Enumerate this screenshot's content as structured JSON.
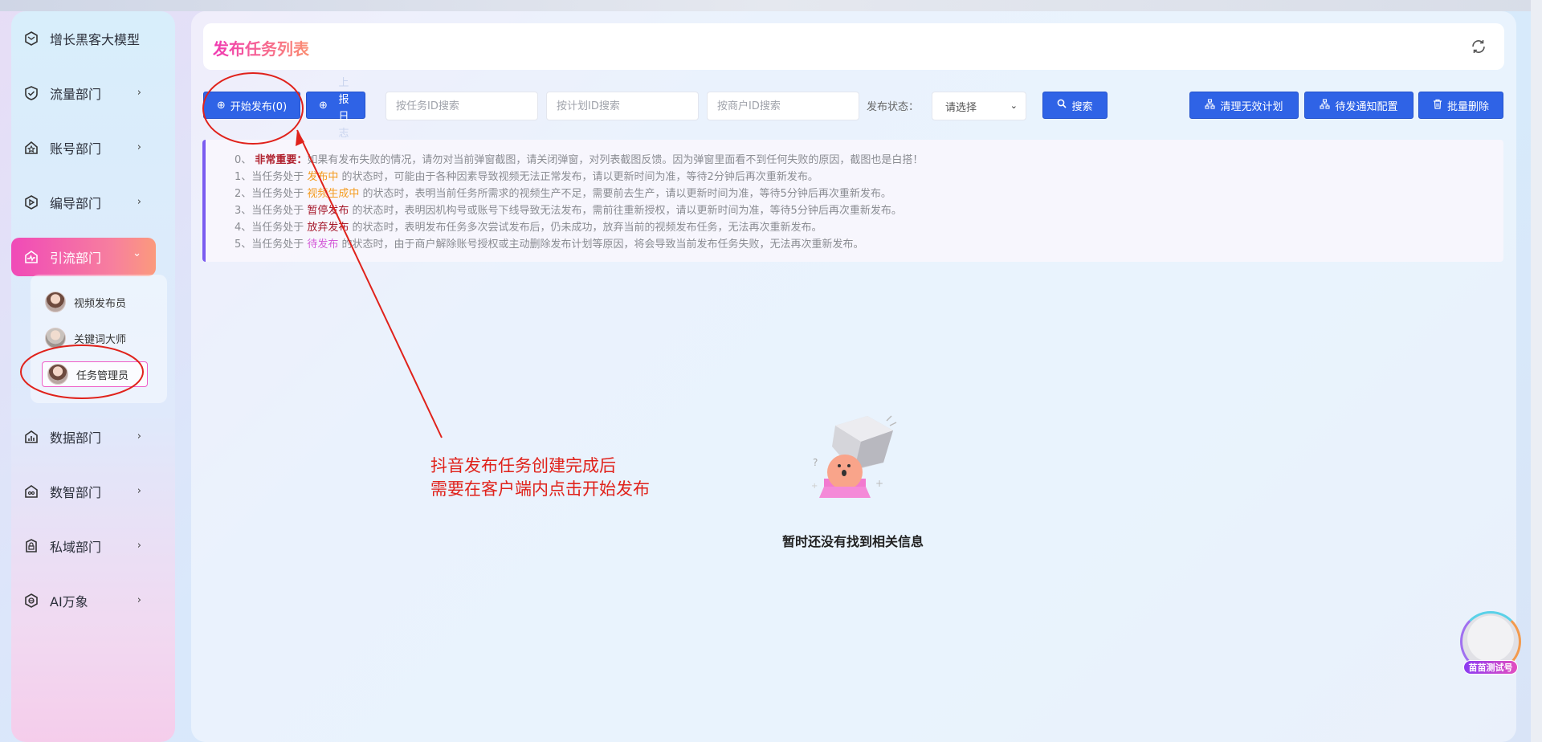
{
  "sidebar": {
    "items": [
      {
        "label": "增长黑客大模型",
        "icon": "hexagon-icon",
        "has_arrow": false
      },
      {
        "label": "流量部门",
        "icon": "shield-check-icon",
        "has_arrow": true
      },
      {
        "label": "账号部门",
        "icon": "home-star-icon",
        "has_arrow": true
      },
      {
        "label": "编导部门",
        "icon": "play-shield-icon",
        "has_arrow": true
      },
      {
        "label": "引流部门",
        "icon": "pulse-icon",
        "has_arrow": true,
        "active": true
      },
      {
        "label": "数据部门",
        "icon": "bar-chart-icon",
        "has_arrow": true
      },
      {
        "label": "数智部门",
        "icon": "robot-icon",
        "has_arrow": true
      },
      {
        "label": "私域部门",
        "icon": "lock-shield-icon",
        "has_arrow": true
      },
      {
        "label": "AI万象",
        "icon": "ai-globe-icon",
        "has_arrow": true
      }
    ],
    "sub_items": [
      {
        "label": "视频发布员"
      },
      {
        "label": "关键词大师"
      },
      {
        "label": "任务管理员",
        "active": true
      }
    ],
    "arrow": "›",
    "arrow_open": "⌄"
  },
  "header": {
    "title": "发布任务列表"
  },
  "toolbar": {
    "start_publish": "开始发布(0)",
    "log_button_chars": [
      "上",
      "报",
      "日",
      "志"
    ],
    "task_id_placeholder": "按任务ID搜索",
    "plan_id_placeholder": "按计划ID搜索",
    "merchant_id_placeholder": "按商户ID搜索",
    "status_label": "发布状态：",
    "status_select": "请选择",
    "search": "搜索",
    "clean_invalid": "清理无效计划",
    "notify_config": "待发通知配置",
    "batch_delete": "批量删除"
  },
  "notice": {
    "lines": [
      {
        "prefix": "0、 ",
        "hl": "非常重要：",
        "hl_class": "hl-red",
        "rest": "如果有发布失败的情况，请勿对当前弹窗截图，请关闭弹窗，对列表截图反馈。因为弹窗里面看不到任何失败的原因，截图也是白搭！"
      },
      {
        "prefix": "1、当任务处于 ",
        "hl": "发布中",
        "hl_class": "hl-orange",
        "rest": " 的状态时，可能由于各种因素导致视频无法正常发布，请以更新时间为准，等待2分钟后再次重新发布。"
      },
      {
        "prefix": "2、当任务处于 ",
        "hl": "视频生成中",
        "hl_class": "hl-orange",
        "rest": " 的状态时，表明当前任务所需求的视频生产不足，需要前去生产，请以更新时间为准，等待5分钟后再次重新发布。"
      },
      {
        "prefix": "3、当任务处于 ",
        "hl": "暂停发布",
        "hl_class": "hl-dark",
        "rest": " 的状态时，表明因机构号或账号下线导致无法发布，需前往重新授权，请以更新时间为准，等待5分钟后再次重新发布。"
      },
      {
        "prefix": "4、当任务处于 ",
        "hl": "放弃发布",
        "hl_class": "hl-dark",
        "rest": " 的状态时，表明发布任务多次尝试发布后，仍未成功，放弃当前的视频发布任务，无法再次重新发布。"
      },
      {
        "prefix": "5、当任务处于 ",
        "hl": "待发布",
        "hl_class": "hl-pink",
        "rest": " 的状态时，由于商户解除账号授权或主动删除发布计划等原因，将会导致当前发布任务失败，无法再次重新发布。"
      }
    ]
  },
  "empty_state": {
    "text": "暂时还没有找到相关信息"
  },
  "annotation": {
    "line1": "抖音发布任务创建完成后",
    "line2": "需要在客户端内点击开始发布"
  },
  "float_widget": {
    "label": "苗苗测试号"
  },
  "colors": {
    "primary_button": "#2f63e6",
    "active_nav_gradient_start": "#f04ab8",
    "active_nav_gradient_end": "#fb9a7c",
    "annotation_red": "#e0221b"
  }
}
